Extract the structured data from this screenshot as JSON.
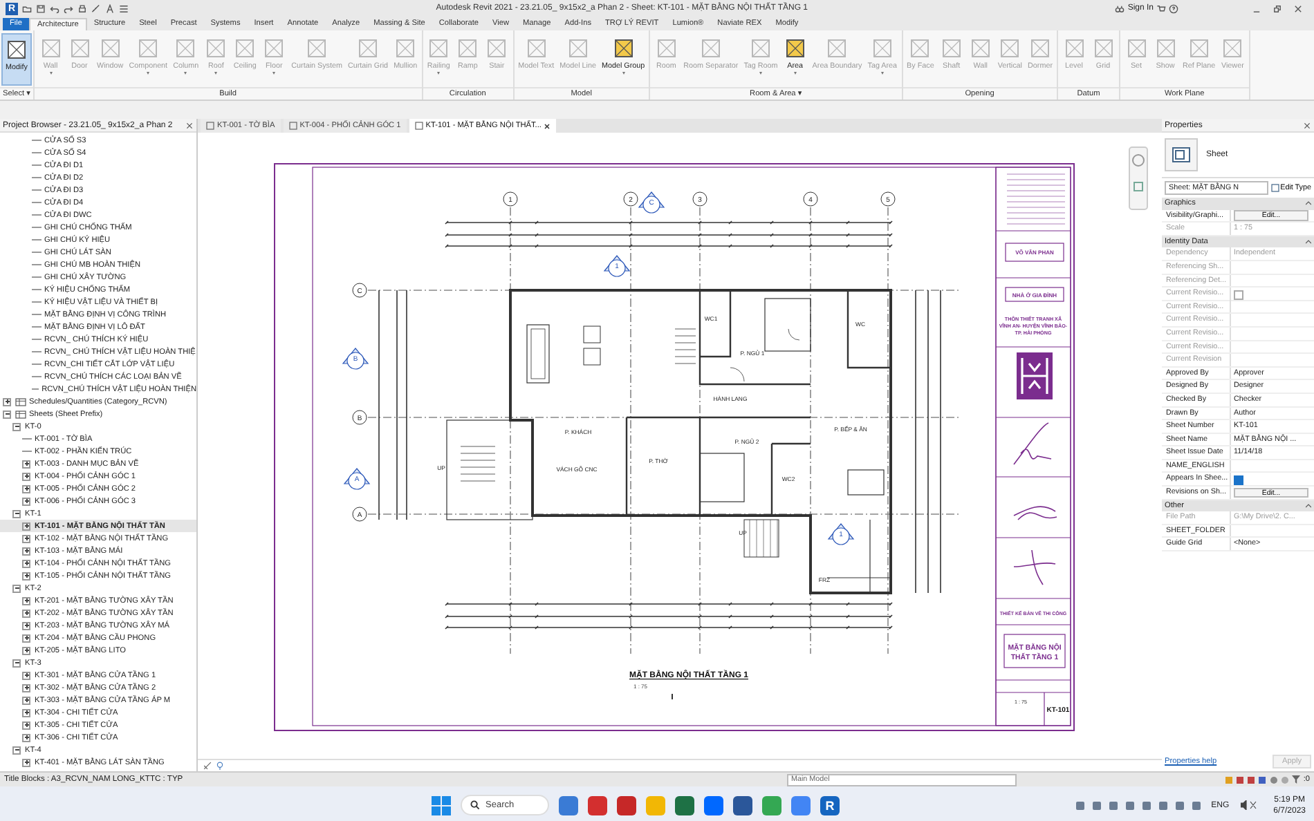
{
  "window": {
    "app_logo": "R",
    "title": "Autodesk Revit 2021 - 23.21.05_ 9x15x2_a Phan 2 - Sheet: KT-101 - MẶT BẰNG NỘI THẤT TẦNG 1",
    "sign_in": "Sign In"
  },
  "ribbon": {
    "tabs": [
      {
        "label": "File",
        "kind": "file",
        "selected": false
      },
      {
        "label": "Architecture",
        "kind": "tab",
        "selected": true
      },
      {
        "label": "Structure",
        "kind": "tab",
        "selected": false
      },
      {
        "label": "Steel",
        "kind": "tab",
        "selected": false
      },
      {
        "label": "Precast",
        "kind": "tab",
        "selected": false
      },
      {
        "label": "Systems",
        "kind": "tab",
        "selected": false
      },
      {
        "label": "Insert",
        "kind": "tab",
        "selected": false
      },
      {
        "label": "Annotate",
        "kind": "tab",
        "selected": false
      },
      {
        "label": "Analyze",
        "kind": "tab",
        "selected": false
      },
      {
        "label": "Massing & Site",
        "kind": "tab",
        "selected": false
      },
      {
        "label": "Collaborate",
        "kind": "tab",
        "selected": false
      },
      {
        "label": "View",
        "kind": "tab",
        "selected": false
      },
      {
        "label": "Manage",
        "kind": "tab",
        "selected": false
      },
      {
        "label": "Add-Ins",
        "kind": "tab",
        "selected": false
      },
      {
        "label": "TRỢ LÝ REVIT",
        "kind": "tab",
        "selected": false
      },
      {
        "label": "Lumion®",
        "kind": "tab",
        "selected": false
      },
      {
        "label": "Naviate REX",
        "kind": "tab",
        "selected": false
      },
      {
        "label": "Modify",
        "kind": "tab",
        "selected": false
      }
    ],
    "panels": [
      {
        "label": "Select ▾",
        "tools": [
          {
            "label": "Modify",
            "selected": true,
            "disabled": false,
            "dropdown": false
          }
        ]
      },
      {
        "label": "Build",
        "tools": [
          {
            "label": "Wall",
            "selected": false,
            "disabled": true,
            "dropdown": true
          },
          {
            "label": "Door",
            "selected": false,
            "disabled": true,
            "dropdown": false
          },
          {
            "label": "Window",
            "selected": false,
            "disabled": true,
            "dropdown": false
          },
          {
            "label": "Component",
            "selected": false,
            "disabled": true,
            "dropdown": true
          },
          {
            "label": "Column",
            "selected": false,
            "disabled": true,
            "dropdown": true
          },
          {
            "label": "Roof",
            "selected": false,
            "disabled": true,
            "dropdown": true
          },
          {
            "label": "Ceiling",
            "selected": false,
            "disabled": true,
            "dropdown": false
          },
          {
            "label": "Floor",
            "selected": false,
            "disabled": true,
            "dropdown": true
          },
          {
            "label": "Curtain System",
            "selected": false,
            "disabled": true,
            "dropdown": false
          },
          {
            "label": "Curtain Grid",
            "selected": false,
            "disabled": true,
            "dropdown": false
          },
          {
            "label": "Mullion",
            "selected": false,
            "disabled": true,
            "dropdown": false
          }
        ]
      },
      {
        "label": "Circulation",
        "tools": [
          {
            "label": "Railing",
            "selected": false,
            "disabled": true,
            "dropdown": true
          },
          {
            "label": "Ramp",
            "selected": false,
            "disabled": true,
            "dropdown": false
          },
          {
            "label": "Stair",
            "selected": false,
            "disabled": true,
            "dropdown": false
          }
        ]
      },
      {
        "label": "Model",
        "tools": [
          {
            "label": "Model Text",
            "selected": false,
            "disabled": true,
            "dropdown": false
          },
          {
            "label": "Model Line",
            "selected": false,
            "disabled": true,
            "dropdown": false
          },
          {
            "label": "Model Group",
            "selected": false,
            "disabled": false,
            "dropdown": true
          }
        ]
      },
      {
        "label": "Room & Area ▾",
        "tools": [
          {
            "label": "Room",
            "selected": false,
            "disabled": true,
            "dropdown": false
          },
          {
            "label": "Room Separator",
            "selected": false,
            "disabled": true,
            "dropdown": false
          },
          {
            "label": "Tag Room",
            "selected": false,
            "disabled": true,
            "dropdown": true
          },
          {
            "label": "Area",
            "selected": false,
            "disabled": false,
            "dropdown": true
          },
          {
            "label": "Area Boundary",
            "selected": false,
            "disabled": true,
            "dropdown": false
          },
          {
            "label": "Tag Area",
            "selected": false,
            "disabled": true,
            "dropdown": true
          }
        ]
      },
      {
        "label": "Opening",
        "tools": [
          {
            "label": "By Face",
            "selected": false,
            "disabled": true,
            "dropdown": false
          },
          {
            "label": "Shaft",
            "selected": false,
            "disabled": true,
            "dropdown": false
          },
          {
            "label": "Wall",
            "selected": false,
            "disabled": true,
            "dropdown": false
          },
          {
            "label": "Vertical",
            "selected": false,
            "disabled": true,
            "dropdown": false
          },
          {
            "label": "Dormer",
            "selected": false,
            "disabled": true,
            "dropdown": false
          }
        ]
      },
      {
        "label": "Datum",
        "tools": [
          {
            "label": "Level",
            "selected": false,
            "disabled": true,
            "dropdown": false
          },
          {
            "label": "Grid",
            "selected": false,
            "disabled": true,
            "dropdown": false
          }
        ]
      },
      {
        "label": "Work Plane",
        "tools": [
          {
            "label": "Set",
            "selected": false,
            "disabled": true,
            "dropdown": false
          },
          {
            "label": "Show",
            "selected": false,
            "disabled": true,
            "dropdown": false
          },
          {
            "label": "Ref Plane",
            "selected": false,
            "disabled": true,
            "dropdown": false
          },
          {
            "label": "Viewer",
            "selected": false,
            "disabled": true,
            "dropdown": false
          }
        ]
      }
    ]
  },
  "browser": {
    "title": "Project Browser - 23.21.05_ 9x15x2_a Phan 2",
    "tree": [
      {
        "children": [
          {
            "label": "CỬA SỔ S3",
            "selected": false
          },
          {
            "label": "CỬA SỔ S4",
            "selected": false
          },
          {
            "label": "CỬA ĐI D1",
            "selected": false
          },
          {
            "label": "CỬA ĐI D2",
            "selected": false
          },
          {
            "label": "CỬA ĐI D3",
            "selected": false
          },
          {
            "label": "CỬA ĐI D4",
            "selected": false
          },
          {
            "label": "CỬA ĐI DWC",
            "selected": false
          },
          {
            "label": "GHI CHÚ CHỐNG THẤM",
            "selected": false
          },
          {
            "label": "GHI CHÚ KÝ HIỆU",
            "selected": false
          },
          {
            "label": "GHI CHÚ LÁT SÀN",
            "selected": false
          },
          {
            "label": "GHI CHÚ MB HOÀN THIỆN",
            "selected": false
          },
          {
            "label": "GHI CHÚ XÂY TƯỜNG",
            "selected": false
          },
          {
            "label": "KÝ HIỆU CHỐNG THẤM",
            "selected": false
          },
          {
            "label": "KÝ HIỆU VẬT LIỆU VÀ THIẾT BỊ",
            "selected": false
          },
          {
            "label": "MẶT BẰNG ĐỊNH VỊ CÔNG TRÌNH",
            "selected": false
          },
          {
            "label": "MẶT BẰNG ĐỊNH VỊ LÔ ĐẤT",
            "selected": false
          },
          {
            "label": "RCVN_ CHÚ THÍCH KÝ HIỆU",
            "selected": false
          },
          {
            "label": "RCVN_ CHÚ THÍCH VẬT LIỆU HOÀN THIỆ",
            "selected": false
          },
          {
            "label": "RCVN_CHI TIẾT CẮT LỚP VẬT LIỆU",
            "selected": false
          },
          {
            "label": "RCVN_CHÚ THÍCH CÁC LOẠI BẢN VẼ",
            "selected": false
          },
          {
            "label": "RCVN_CHÚ THÍCH VẬT LIỆU HOÀN THIỆN",
            "selected": false
          }
        ]
      },
      {
        "label": "Schedules/Quantities (Category_RCVN)",
        "kind": "category",
        "expanded": false,
        "selected": false
      },
      {
        "label": "Sheets (Sheet Prefix)",
        "kind": "category",
        "expanded": true,
        "selected": false,
        "children": [
          {
            "label": "KT-0",
            "expanded": true,
            "selected": false,
            "children": [
              {
                "label": "KT-001 - TỜ BÌA",
                "selected": false
              },
              {
                "label": "KT-002 - PHẦN KIẾN TRÚC",
                "selected": false
              },
              {
                "label": "KT-003 - DANH MỤC BẢN VẼ",
                "expanded": false,
                "selected": false
              },
              {
                "label": "KT-004 - PHỐI CẢNH GÓC 1",
                "expanded": false,
                "selected": false
              },
              {
                "label": "KT-005 - PHỐI CẢNH GÓC 2",
                "expanded": false,
                "selected": false
              },
              {
                "label": "KT-006 - PHỐI CẢNH GÓC 3",
                "expanded": false,
                "selected": false
              }
            ]
          },
          {
            "label": "KT-1",
            "expanded": true,
            "selected": false,
            "children": [
              {
                "label": "KT-101 - MẶT BẰNG NỘI THẤT TẦN",
                "expanded": false,
                "selected": true
              },
              {
                "label": "KT-102 - MẶT BẰNG NỘI THẤT TẦNG",
                "expanded": false,
                "selected": false
              },
              {
                "label": "KT-103 - MẶT BẰNG MÁI",
                "expanded": false,
                "selected": false
              },
              {
                "label": "KT-104 - PHỐI CẢNH NỘI THẤT TẦNG",
                "expanded": false,
                "selected": false
              },
              {
                "label": "KT-105 - PHỐI CẢNH NỘI THẤT TẦNG",
                "expanded": false,
                "selected": false
              }
            ]
          },
          {
            "label": "KT-2",
            "expanded": true,
            "selected": false,
            "children": [
              {
                "label": "KT-201 - MẶT BẰNG TƯỜNG XÂY TẦN",
                "expanded": false,
                "selected": false
              },
              {
                "label": "KT-202 - MẶT BẰNG TƯỜNG XÂY TẦN",
                "expanded": false,
                "selected": false
              },
              {
                "label": "KT-203 - MẶT BẰNG TƯỜNG XÂY MÁ",
                "expanded": false,
                "selected": false
              },
              {
                "label": "KT-204 - MẶT BẰNG CẦU PHONG",
                "expanded": false,
                "selected": false
              },
              {
                "label": "KT-205 - MẶT BẰNG LITO",
                "expanded": false,
                "selected": false
              }
            ]
          },
          {
            "label": "KT-3",
            "expanded": true,
            "selected": false,
            "children": [
              {
                "label": "KT-301 - MẶT BẰNG CỬA TẦNG 1",
                "expanded": false,
                "selected": false
              },
              {
                "label": "KT-302 - MẶT BẰNG CỬA TẦNG 2",
                "expanded": false,
                "selected": false
              },
              {
                "label": "KT-303 - MẶT BẰNG CỬA TẦNG ÁP M",
                "expanded": false,
                "selected": false
              },
              {
                "label": "KT-304 - CHI TIẾT CỬA",
                "expanded": false,
                "selected": false
              },
              {
                "label": "KT-305 - CHI TIẾT CỬA",
                "expanded": false,
                "selected": false
              },
              {
                "label": "KT-306 - CHI TIẾT CỬA",
                "expanded": false,
                "selected": false
              }
            ]
          },
          {
            "label": "KT-4",
            "expanded": true,
            "selected": false,
            "children": [
              {
                "label": "KT-401 - MẶT BẰNG LÁT SÀN TẦNG",
                "expanded": false,
                "selected": false
              }
            ]
          }
        ]
      }
    ]
  },
  "view_tabs": [
    {
      "label": "KT-001 - TỜ BÌA",
      "selected": false
    },
    {
      "label": "KT-004 - PHỐI CẢNH GÓC 1",
      "selected": false
    },
    {
      "label": "KT-101 - MẶT BẰNG NỘI THẤT...",
      "selected": true
    }
  ],
  "sheet": {
    "grid_columns": [
      "1",
      "2",
      "3",
      "4",
      "5"
    ],
    "grid_rows": [
      "C",
      "B",
      "A"
    ],
    "section_marks": [
      {
        "label": "C"
      },
      {
        "label": "1"
      },
      {
        "label": "B"
      },
      {
        "label": "A"
      },
      {
        "label": "1"
      }
    ],
    "rooms": [
      "WC1",
      "WC",
      "P. NGỦ 1",
      "HÀNH LANG",
      "P. BẾP & ĂN",
      "P. KHÁCH",
      "P. NGỦ 2",
      "P. THỜ",
      "UP",
      "VÁCH GỖ CNC",
      "WC2",
      "UP",
      "FRZ"
    ],
    "plan_title": "MẶT BẰNG NỘI THẤT TẦNG 1",
    "plan_scale": "1 : 75",
    "title_block": {
      "designer": "VÕ VĂN PHAN",
      "project": "NHÀ Ở GIA ĐÌNH",
      "address_lines": [
        "THÔN THIẾT TRANH XÃ",
        "VĨNH AN- HUYỆN VĨNH BẢO-",
        "TP. HẢI PHÒNG"
      ],
      "stage": "THIẾT KẾ BẢN VẼ THI CÔNG",
      "sheet_title_lines": [
        "MẶT BẰNG NỘI",
        "THẤT TẦNG 1"
      ],
      "scale": "1 : 75",
      "sheet_number": "KT-101"
    }
  },
  "properties": {
    "title": "Properties",
    "type_name": "Sheet",
    "selector": "Sheet: MẶT BẰNG N",
    "edit_type": "Edit Type",
    "groups": [
      {
        "label": "Graphics",
        "rows": [
          {
            "name": "Visibility/Graphi...",
            "kind": "button",
            "value": "Edit...",
            "disabled": false
          },
          {
            "name": "Scale",
            "kind": "text",
            "value": "1 : 75",
            "disabled": true
          }
        ]
      },
      {
        "label": "Identity Data",
        "rows": [
          {
            "name": "Dependency",
            "kind": "text",
            "value": "Independent",
            "disabled": true
          },
          {
            "name": "Referencing Sh...",
            "kind": "text",
            "disabled": true
          },
          {
            "name": "Referencing Det...",
            "kind": "text",
            "disabled": true
          },
          {
            "name": "Current Revisio...",
            "kind": "checkbox",
            "checked": false,
            "disabled": true
          },
          {
            "name": "Current Revisio...",
            "kind": "text",
            "disabled": true
          },
          {
            "name": "Current Revisio...",
            "kind": "text",
            "disabled": true
          },
          {
            "name": "Current Revisio...",
            "kind": "text",
            "disabled": true
          },
          {
            "name": "Current Revisio...",
            "kind": "text",
            "disabled": true
          },
          {
            "name": "Current Revision",
            "kind": "text",
            "disabled": true
          },
          {
            "name": "Approved By",
            "kind": "text",
            "value": "Approver",
            "disabled": false
          },
          {
            "name": "Designed By",
            "kind": "text",
            "value": "Designer",
            "disabled": false
          },
          {
            "name": "Checked By",
            "kind": "text",
            "value": "Checker",
            "disabled": false
          },
          {
            "name": "Drawn By",
            "kind": "text",
            "value": "Author",
            "disabled": false
          },
          {
            "name": "Sheet Number",
            "kind": "text",
            "value": "KT-101",
            "disabled": false
          },
          {
            "name": "Sheet Name",
            "kind": "text",
            "value": "MẶT BẰNG NỘI ...",
            "disabled": false
          },
          {
            "name": "Sheet Issue Date",
            "kind": "text",
            "value": "11/14/18",
            "disabled": false
          },
          {
            "name": "NAME_ENGLISH",
            "kind": "text",
            "disabled": false
          },
          {
            "name": "Appears In Shee...",
            "kind": "checkbox",
            "checked": true,
            "disabled": false
          },
          {
            "name": "Revisions on Sh...",
            "kind": "button",
            "value": "Edit...",
            "disabled": false
          }
        ]
      },
      {
        "label": "Other",
        "rows": [
          {
            "name": "File Path",
            "kind": "text",
            "value": "G:\\My Drive\\2. C...",
            "disabled": true
          },
          {
            "name": "SHEET_FOLDER",
            "kind": "text",
            "disabled": false
          },
          {
            "name": "Guide Grid",
            "kind": "text",
            "value": "<None>",
            "disabled": false
          }
        ]
      }
    ],
    "help": "Properties help",
    "apply": "Apply",
    "apply_disabled": true
  },
  "status_bar": {
    "text": "Title Blocks : A3_RCVN_NAM LONG_KTTC : TYP",
    "workset": "Main Model",
    "filter_count": ":0"
  },
  "taskbar": {
    "search": "Search",
    "apps": [
      {
        "color": "#3a7bd5"
      },
      {
        "color": "#d32f2f"
      },
      {
        "color": "#c62828"
      },
      {
        "color": "#f2b705"
      },
      {
        "color": "#1e7145"
      },
      {
        "color": "#0068ff"
      },
      {
        "color": "#2b579a"
      },
      {
        "color": "#34a853"
      },
      {
        "color": "#4285f4"
      },
      {
        "color": "#1565c0",
        "glyph": "R"
      }
    ],
    "language": "ENG",
    "time": "5:19 PM",
    "date": "6/7/2023"
  }
}
